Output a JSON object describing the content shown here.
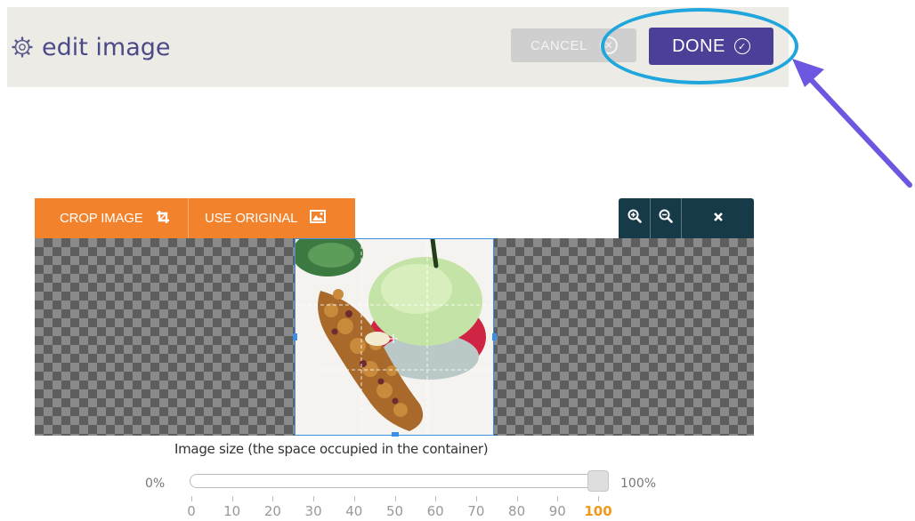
{
  "header": {
    "title": "edit image",
    "cancel_label": "CANCEL",
    "done_label": "DONE"
  },
  "toolbar": {
    "crop_label": "CROP IMAGE",
    "original_label": "USE ORIGINAL",
    "zoom_in_icon": "zoom-in-icon",
    "zoom_out_icon": "zoom-out-icon",
    "close_icon": "close-icon"
  },
  "size_control": {
    "label": "Image size (the space occupied in the container)",
    "min_label": "0%",
    "max_label": "100%",
    "value_percent": 100,
    "ticks": [
      "0",
      "10",
      "20",
      "30",
      "40",
      "50",
      "60",
      "70",
      "80",
      "90",
      "100"
    ]
  },
  "colors": {
    "accent_orange": "#f3822c",
    "done_purple": "#4c3f97",
    "highlight_blue": "#1fa6dc",
    "arrow_purple": "#6b57e0",
    "toolbar_dark": "#173a49"
  }
}
